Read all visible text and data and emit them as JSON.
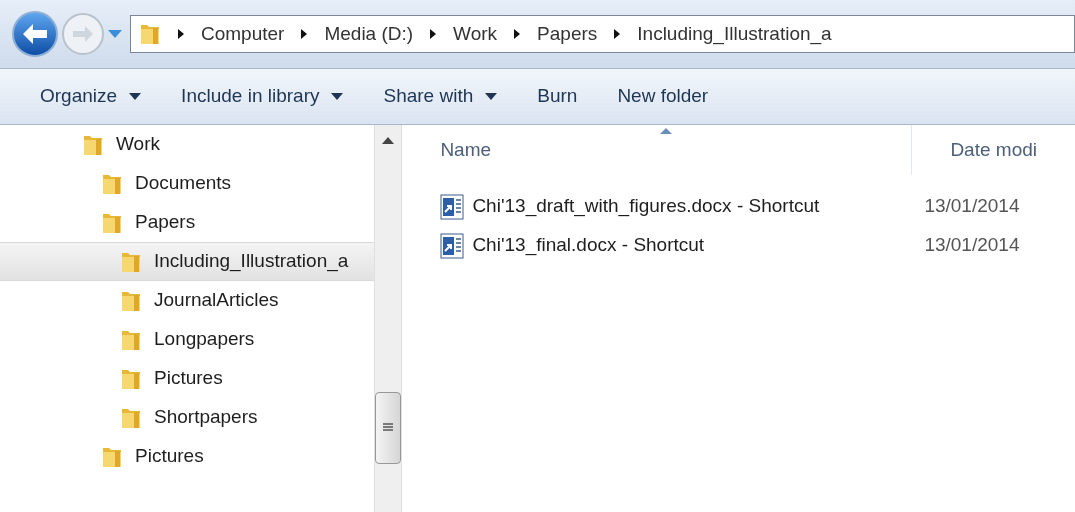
{
  "breadcrumb": [
    "Computer",
    "Media (D:)",
    "Work",
    "Papers",
    "Including_Illustration_a"
  ],
  "toolbar": [
    {
      "label": "Organize",
      "dropdown": true
    },
    {
      "label": "Include in library",
      "dropdown": true
    },
    {
      "label": "Share with",
      "dropdown": true
    },
    {
      "label": "Burn",
      "dropdown": false
    },
    {
      "label": "New folder",
      "dropdown": false
    }
  ],
  "tree": [
    {
      "label": "Work",
      "selected": false,
      "children": [
        {
          "label": "Documents",
          "selected": false
        },
        {
          "label": "Papers",
          "selected": false,
          "children": [
            {
              "label": "Including_Illustration_a",
              "selected": true
            },
            {
              "label": "JournalArticles",
              "selected": false
            },
            {
              "label": "Longpapers",
              "selected": false
            },
            {
              "label": "Pictures",
              "selected": false
            },
            {
              "label": "Shortpapers",
              "selected": false
            }
          ]
        },
        {
          "label": "Pictures",
          "selected": false
        }
      ]
    }
  ],
  "columns": [
    {
      "label": "Name",
      "sorted": true
    },
    {
      "label": "Date modi",
      "sorted": false
    }
  ],
  "files": [
    {
      "name": "Chi'13_draft_with_figures.docx - Shortcut",
      "date": "13/01/2014"
    },
    {
      "name": "Chi'13_final.docx - Shortcut",
      "date": "13/01/2014"
    }
  ]
}
